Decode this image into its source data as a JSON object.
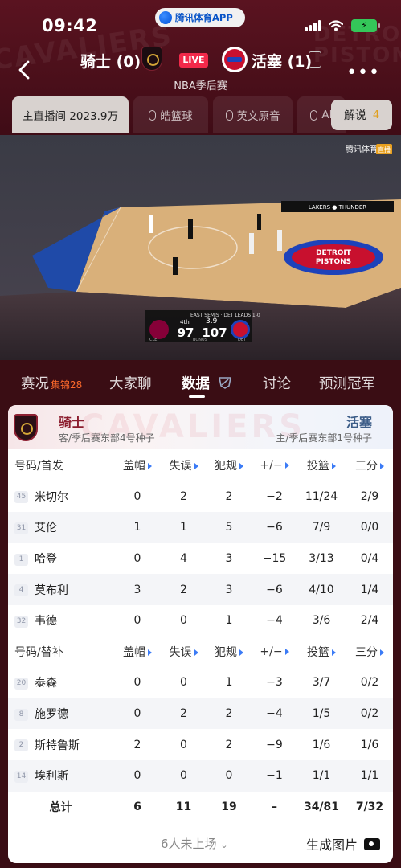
{
  "status": {
    "time": "09:42",
    "app_name": "腾讯体育APP"
  },
  "match": {
    "home_team": "骑士 (0)",
    "away_team": "活塞 (1)",
    "live_label": "LIVE",
    "subtitle": "NBA季后赛"
  },
  "stream_tabs": [
    {
      "label": "主直播间 2023.9万",
      "selected": true
    },
    {
      "label": "皓篮球",
      "icon": "mic-icon"
    },
    {
      "label": "英文原音",
      "icon": "mic-icon"
    },
    {
      "label": "AI",
      "icon": "mic-icon"
    }
  ],
  "commentary": {
    "label": "解说",
    "count": "4"
  },
  "video": {
    "watermark": "腾讯体育",
    "watermark_tag": "直播",
    "scorebug": {
      "series": "EAST SEMIS · DET LEADS 1-0",
      "quarter": "4th",
      "clock": "3.9",
      "away_abbr": "CLE",
      "home_abbr": "DET",
      "away_score": "97",
      "home_score": "107",
      "bonus": "BONUS"
    },
    "court_logo": "DETROIT PISTONS",
    "ad_board": "LAKERS ● THUNDER"
  },
  "bottom_tabs": [
    {
      "label": "赛况",
      "sub": "集锦28"
    },
    {
      "label": "大家聊"
    },
    {
      "label": "数据",
      "active": true
    },
    {
      "label": "讨论"
    },
    {
      "label": "预测冠军"
    }
  ],
  "card": {
    "watermark": "CAVALIERS",
    "left_team": "骑士",
    "left_sub": "客/季后赛东部4号种子",
    "right_team": "活塞",
    "right_sub": "主/季后赛东部1号种子"
  },
  "starters_header": [
    "号码/首发",
    "盖帽",
    "失误",
    "犯规",
    "+/−",
    "投篮",
    "三分"
  ],
  "starters": [
    {
      "num": "45",
      "name": "米切尔",
      "stats": [
        "0",
        "2",
        "2",
        "−2",
        "11/24",
        "2/9"
      ]
    },
    {
      "num": "31",
      "name": "艾伦",
      "stats": [
        "1",
        "1",
        "5",
        "−6",
        "7/9",
        "0/0"
      ]
    },
    {
      "num": "1",
      "name": "哈登",
      "stats": [
        "0",
        "4",
        "3",
        "−15",
        "3/13",
        "0/4"
      ]
    },
    {
      "num": "4",
      "name": "莫布利",
      "stats": [
        "3",
        "2",
        "3",
        "−6",
        "4/10",
        "1/4"
      ]
    },
    {
      "num": "32",
      "name": "韦德",
      "stats": [
        "0",
        "0",
        "1",
        "−4",
        "3/6",
        "2/4"
      ]
    }
  ],
  "bench_header": [
    "号码/替补",
    "盖帽",
    "失误",
    "犯规",
    "+/−",
    "投篮",
    "三分"
  ],
  "bench": [
    {
      "num": "20",
      "name": "泰森",
      "stats": [
        "0",
        "0",
        "1",
        "−3",
        "3/7",
        "0/2"
      ]
    },
    {
      "num": "8",
      "name": "施罗德",
      "stats": [
        "0",
        "2",
        "2",
        "−4",
        "1/5",
        "0/2"
      ]
    },
    {
      "num": "2",
      "name": "斯特鲁斯",
      "stats": [
        "2",
        "0",
        "2",
        "−9",
        "1/6",
        "1/6"
      ]
    },
    {
      "num": "14",
      "name": "埃利斯",
      "stats": [
        "0",
        "0",
        "0",
        "−1",
        "1/1",
        "1/1"
      ]
    }
  ],
  "totals": {
    "label": "总计",
    "stats": [
      "6",
      "11",
      "19",
      "–",
      "34/81",
      "7/32"
    ]
  },
  "footer": {
    "not_played": "6人未上场",
    "generate_image": "生成图片"
  },
  "colors": {
    "live": "#f2294a",
    "cavs": "#8c1d2e",
    "pistons": "#c8102e",
    "accent": "#3b7bf6"
  }
}
